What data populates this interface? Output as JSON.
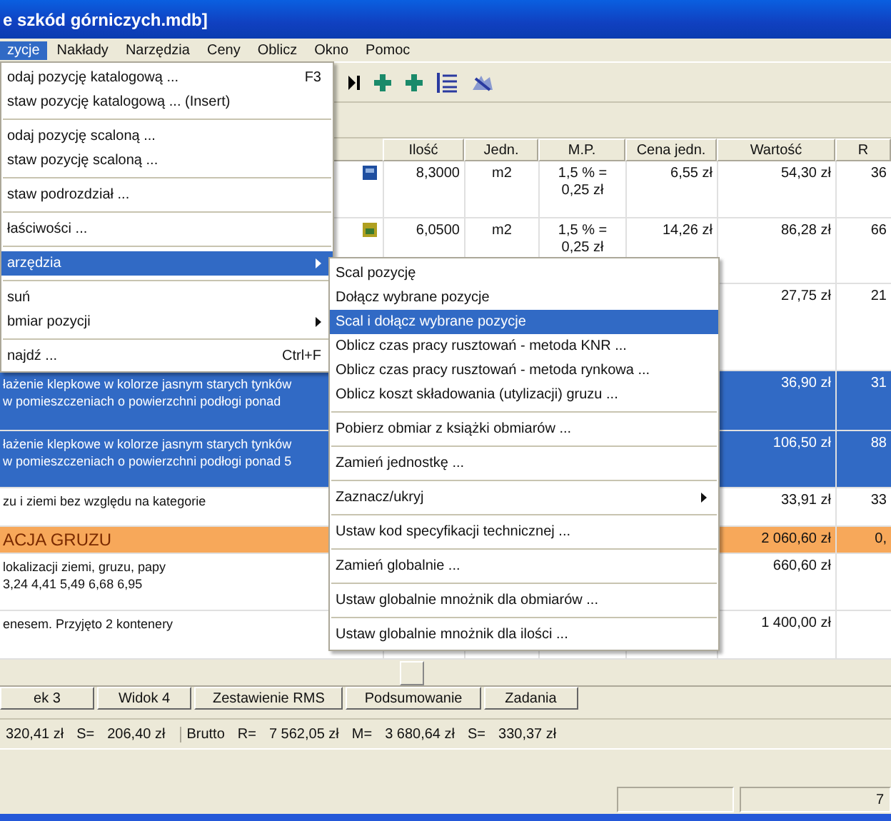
{
  "window": {
    "title": "e szkód górniczych.mdb]"
  },
  "menu_bar": [
    {
      "label": "zycje",
      "selected": true
    },
    {
      "label": "Nakłady",
      "selected": false
    },
    {
      "label": "Narzędzia",
      "selected": false
    },
    {
      "label": "Ceny",
      "selected": false
    },
    {
      "label": "Oblicz",
      "selected": false
    },
    {
      "label": "Okno",
      "selected": false
    },
    {
      "label": "Pomoc",
      "selected": false
    }
  ],
  "main_menu": [
    {
      "kind": "item",
      "label": "odaj pozycję katalogową ...",
      "shortcut": "F3",
      "selected": false
    },
    {
      "kind": "item",
      "label": "staw pozycję katalogową ... (Insert)",
      "selected": false
    },
    {
      "kind": "separator"
    },
    {
      "kind": "item",
      "label": "odaj pozycję scaloną ...",
      "selected": false
    },
    {
      "kind": "item",
      "label": "staw pozycję scaloną ...",
      "selected": false
    },
    {
      "kind": "separator"
    },
    {
      "kind": "item",
      "label": "staw podrozdział ...",
      "selected": false
    },
    {
      "kind": "separator"
    },
    {
      "kind": "item",
      "label": "łaściwości ...",
      "selected": false
    },
    {
      "kind": "separator"
    },
    {
      "kind": "submenu",
      "label": "arzędzia",
      "selected": true
    },
    {
      "kind": "separator"
    },
    {
      "kind": "item",
      "label": "suń",
      "selected": false
    },
    {
      "kind": "submenu",
      "label": "bmiar pozycji",
      "selected": false
    },
    {
      "kind": "separator"
    },
    {
      "kind": "item",
      "label": "najdź ...",
      "shortcut": "Ctrl+F",
      "selected": false
    }
  ],
  "submenu": [
    {
      "kind": "item",
      "label": "Scal pozycję",
      "selected": false
    },
    {
      "kind": "item",
      "label": "Dołącz wybrane pozycje",
      "selected": false
    },
    {
      "kind": "item",
      "label": "Scal i dołącz wybrane pozycje",
      "selected": true
    },
    {
      "kind": "item",
      "label": "Oblicz czas pracy rusztowań - metoda KNR ...",
      "selected": false
    },
    {
      "kind": "item",
      "label": "Oblicz czas pracy rusztowań - metoda rynkowa ...",
      "selected": false
    },
    {
      "kind": "item",
      "label": "Oblicz koszt składowania (utylizacji) gruzu ...",
      "selected": false
    },
    {
      "kind": "separator"
    },
    {
      "kind": "item",
      "label": "Pobierz obmiar z książki obmiarów ...",
      "selected": false
    },
    {
      "kind": "separator"
    },
    {
      "kind": "item",
      "label": "Zamień jednostkę ...",
      "selected": false
    },
    {
      "kind": "separator"
    },
    {
      "kind": "submenu",
      "label": "Zaznacz/ukryj",
      "selected": false
    },
    {
      "kind": "separator"
    },
    {
      "kind": "item",
      "label": "Ustaw kod specyfikacji technicznej ...",
      "selected": false
    },
    {
      "kind": "separator"
    },
    {
      "kind": "item",
      "label": "Zamień globalnie ...",
      "selected": false
    },
    {
      "kind": "separator"
    },
    {
      "kind": "item",
      "label": "Ustaw globalnie mnożnik dla obmiarów ...",
      "selected": false
    },
    {
      "kind": "separator"
    },
    {
      "kind": "item",
      "label": "Ustaw globalnie mnożnik dla ilości ...",
      "selected": false
    }
  ],
  "table": {
    "columns": [
      "Ilość",
      "Jedn.",
      "M.P.",
      "Cena jedn.",
      "Wartość",
      "R"
    ],
    "rows": [
      {
        "kind": "labor",
        "selected": false,
        "cells": [
          "8,3000",
          "m2",
          "1,5 % = 0,25 zł",
          "6,55 zł",
          "54,30 zł",
          "36"
        ]
      },
      {
        "kind": "material",
        "selected": false,
        "cells": [
          "6,0500",
          "m2",
          "1,5 % = 0,25 zł",
          "14,26 zł",
          "86,28 zł",
          "66"
        ]
      },
      {
        "kind": "item",
        "selected": false,
        "cells": [
          "",
          "",
          "",
          "",
          "27,75 zł",
          "21"
        ]
      },
      {
        "kind": "item",
        "selected": true,
        "description": [
          "łażenie klepkowe w kolorze jasnym starych tynków",
          "w pomieszczeniach o powierzchni podłogi ponad"
        ],
        "cells": [
          "",
          "",
          "",
          "",
          "36,90 zł",
          "31"
        ]
      },
      {
        "kind": "item",
        "selected": true,
        "description": [
          "łażenie klepkowe w kolorze jasnym starych tynków",
          "w pomieszczeniach o powierzchni podłogi ponad 5"
        ],
        "cells": [
          "",
          "",
          "",
          "",
          "106,50 zł",
          "88"
        ]
      },
      {
        "kind": "item",
        "selected": false,
        "description": [
          "zu i ziemi bez względu na kategorie"
        ],
        "cells": [
          "",
          "",
          "",
          "",
          "33,91 zł",
          "33"
        ]
      },
      {
        "kind": "group",
        "selected": false,
        "description": [
          "ACJA GRUZU"
        ],
        "cells": [
          "",
          "",
          "",
          "",
          "2 060,60 zł",
          "0,"
        ]
      },
      {
        "kind": "item",
        "selected": false,
        "description": [
          "lokalizacji ziemi, gruzu, papy",
          "3,24 4,41 5,49 6,68 6,95"
        ],
        "cells": [
          "",
          "",
          "",
          "",
          "660,60 zł",
          ""
        ]
      },
      {
        "kind": "item",
        "selected": false,
        "description": [
          "enesem. Przyjęto 2 kontenery"
        ],
        "cells": [
          "",
          "",
          "",
          "",
          "1 400,00 zł",
          ""
        ]
      }
    ]
  },
  "tabs": [
    "ek 3",
    "Widok 4",
    "Zestawienie RMS",
    "Podsumowanie",
    "Zadania"
  ],
  "totals": [
    {
      "items": [
        "320,41 zł",
        "S=",
        "206,40 zł"
      ]
    },
    {
      "items": [
        "Brutto",
        "R=",
        "7 562,05 zł",
        "M=",
        "3 680,64 zł",
        "S=",
        "330,37 zł"
      ]
    }
  ],
  "status_bar": [
    "7"
  ]
}
